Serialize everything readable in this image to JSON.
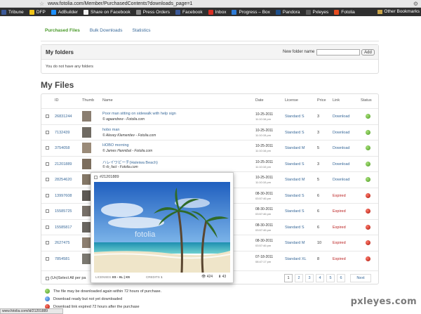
{
  "browser": {
    "url": "www.fotolia.com/Member/PurchasedContents?downloads_page=1",
    "bookmarks": [
      {
        "label": "Tribune",
        "color": "#3b5998"
      },
      {
        "label": "DFP",
        "color": "#f0c419"
      },
      {
        "label": "AdBuilder",
        "color": "#1e90ff"
      },
      {
        "label": "Share on Facebook",
        "color": "#f0f0f0"
      },
      {
        "label": "Press Orders",
        "color": "#888888"
      },
      {
        "label": "Facebook",
        "color": "#3b5998"
      },
      {
        "label": "Inbox",
        "color": "#d93025"
      },
      {
        "label": "Progress – Box",
        "color": "#2e7bd6"
      },
      {
        "label": "Pandora",
        "color": "#1e4f8a"
      },
      {
        "label": "Pxleyes",
        "color": "#5a5a5a"
      },
      {
        "label": "Fotolia",
        "color": "#e64c1f"
      }
    ],
    "other_bookmarks": "Other Bookmarks",
    "status_url": "www.fotolia.com/id/21201889"
  },
  "tabs": [
    "Purchased Files",
    "Bulk Downloads",
    "Statistics"
  ],
  "folders": {
    "title": "My folders",
    "new_folder_label": "New folder name",
    "add_label": "Add",
    "empty_text": "You do not have any folders"
  },
  "files_title": "My Files",
  "table": {
    "headers": [
      "ID",
      "Thumb",
      "Name",
      "Date",
      "License",
      "Price",
      "Link",
      "Status"
    ],
    "rows": [
      {
        "id": "26831244",
        "name": "Poor man sitting on sidewalk with help sign",
        "author": "© agaandrew - Fotolia.com",
        "date": "10-25-2011",
        "time": "11:10:16 pm",
        "license": "Standard S",
        "price": "3",
        "link": "Download",
        "status": "green"
      },
      {
        "id": "7132439",
        "name": "hobo man",
        "author": "© Alexey Klementiev - Fotolia.com",
        "date": "10-25-2011",
        "time": "11:10:15 pm",
        "license": "Standard S",
        "price": "3",
        "link": "Download",
        "status": "green"
      },
      {
        "id": "3754058",
        "name": "HOBO morning",
        "author": "© James Hannibal - Fotolia.com",
        "date": "10-25-2011",
        "time": "11:10:16 pm",
        "license": "Standard M",
        "price": "5",
        "link": "Download",
        "status": "green"
      },
      {
        "id": "21201889",
        "name": "ハレイワビーチ(Haleiwa Beach)",
        "author": "© rb_fact - Fotolia.com",
        "date": "10-25-2011",
        "time": "11:10:10 pm",
        "license": "Standard S",
        "price": "3",
        "link": "Download",
        "status": "green"
      },
      {
        "id": "28254620",
        "name": "",
        "author": "",
        "date": "10-25-2011",
        "time": "11:10:10 pm",
        "license": "Standard M",
        "price": "5",
        "link": "Download",
        "status": "green"
      },
      {
        "id": "13997608",
        "name": "",
        "author": "",
        "date": "08-30-2011",
        "time": "03:57:46 pm",
        "license": "Standard S",
        "price": "6",
        "link": "Expired",
        "status": "red"
      },
      {
        "id": "15585725",
        "name": "",
        "author": "",
        "date": "08-30-2011",
        "time": "03:57:46 pm",
        "license": "Standard S",
        "price": "6",
        "link": "Expired",
        "status": "red"
      },
      {
        "id": "15585817",
        "name": "",
        "author": "",
        "date": "08-30-2011",
        "time": "03:57:46 pm",
        "license": "Standard S",
        "price": "6",
        "link": "Expired",
        "status": "red"
      },
      {
        "id": "2627475",
        "name": "",
        "author": "",
        "date": "08-30-2011",
        "time": "03:57:46 pm",
        "license": "Standard M",
        "price": "10",
        "link": "Expired",
        "status": "red"
      },
      {
        "id": "7854581",
        "name": "",
        "author": "",
        "date": "07-18-2011",
        "time": "08:47:17 pm",
        "license": "Standard XL",
        "price": "8",
        "link": "Expired",
        "status": "red"
      }
    ],
    "footer_select": "(Un)Select All per pa",
    "pages": [
      "1",
      "2",
      "3",
      "4",
      "5",
      "6"
    ],
    "next_label": "Next"
  },
  "popup": {
    "id": "#21201889",
    "watermark": "fotolia",
    "licenses_label": "LICENSES",
    "licenses": "XS - XL | X",
    "licenses_tail": "S",
    "credits_label": "CREDITS",
    "credits": "1",
    "views": "424",
    "downloads": "43"
  },
  "legend": [
    {
      "text": "The file may be downloaded again within 72 hours of purchase.",
      "color": "green"
    },
    {
      "text": "Download ready but not yet downloaded",
      "color": "blue"
    },
    {
      "text": "Download link expired 72 hours after the purchase",
      "color": "red"
    }
  ],
  "site_watermark": "pxleyes.com"
}
